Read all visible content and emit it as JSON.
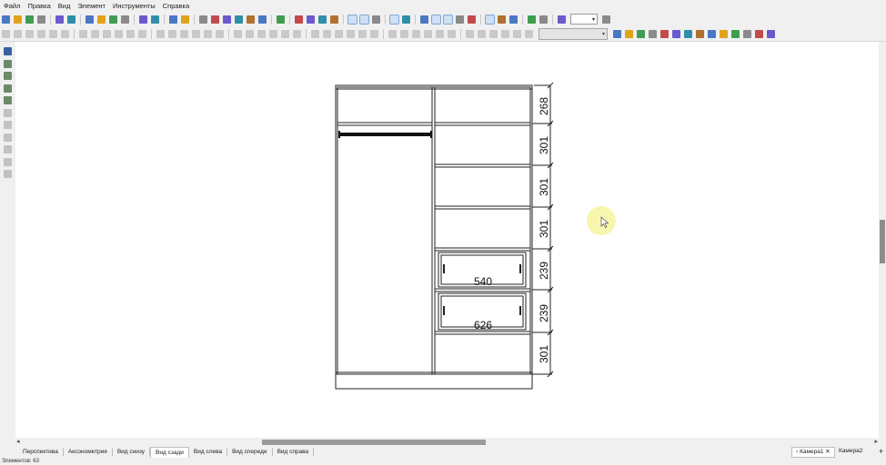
{
  "menu": [
    "Файл",
    "Правка",
    "Вид",
    "Элемент",
    "Инструменты",
    "Справка"
  ],
  "toolbar1": {
    "icons": [
      "new-file-icon",
      "open-folder-icon",
      "save-icon",
      "save-as-icon",
      "sep",
      "print-icon",
      "print-preview-icon",
      "sep",
      "cut-icon",
      "copy-icon",
      "paste-icon",
      "delete-icon",
      "sep",
      "undo-icon",
      "redo-icon",
      "sep",
      "snap-icon",
      "properties-icon",
      "sep",
      "fit-view-icon",
      "zoom-icon",
      "connect-icon",
      "tree-icon",
      "cube-icon",
      "light-icon",
      "sep",
      "library-icon",
      "sep",
      "view-front-icon",
      "view-wire-icon",
      "view-shaded-icon",
      "view-render-icon",
      "sep",
      "frame1-icon",
      "frame2-icon",
      "frame3-icon",
      "sep",
      "grid-icon",
      "bulb-icon",
      "sep",
      "tag-icon",
      "dim-icon",
      "select-box-icon",
      "table-icon",
      "eye-icon",
      "sep",
      "move-icon",
      "pivot-icon",
      "link-icon",
      "sep",
      "magnet-icon",
      "target-icon",
      "sep",
      "zoom-small-icon"
    ],
    "zoom_value": ""
  },
  "toolbar2": {
    "dropdown_value": "",
    "icons": [
      "grid-snap-icon",
      "copy-props-icon",
      "paste-props-icon",
      "rotate-icon",
      "mirror-icon",
      "align-icon",
      "spread-icon",
      "undo-alt-icon",
      "redo-alt-icon",
      "flip-icon",
      "ellipse-icon",
      "stack-icon",
      "camera-small-icon",
      "stop-icon"
    ]
  },
  "left_toolbar": [
    "select-arrow-icon",
    "panel-icon",
    "dimension-icon",
    "ruler-icon",
    "pipette-icon",
    "eraser-icon",
    "edge-icon",
    "brush-icon",
    "hinge-icon",
    "hanger-icon",
    "zoom-tool-icon"
  ],
  "drawing": {
    "dimensions": [
      "268",
      "301",
      "301",
      "301",
      "239",
      "239",
      "301"
    ],
    "drawer_labels": [
      "540",
      "626"
    ]
  },
  "tabs": [
    "Перспектива",
    "Аксонометрия",
    "Вид снизу",
    "Вид сзади",
    "Вид слева",
    "Вид спереди",
    "Вид справа"
  ],
  "active_tab": "Вид сзади",
  "camera_tabs": [
    "Камера1",
    "Камера2"
  ],
  "status": "Элементов: 63"
}
